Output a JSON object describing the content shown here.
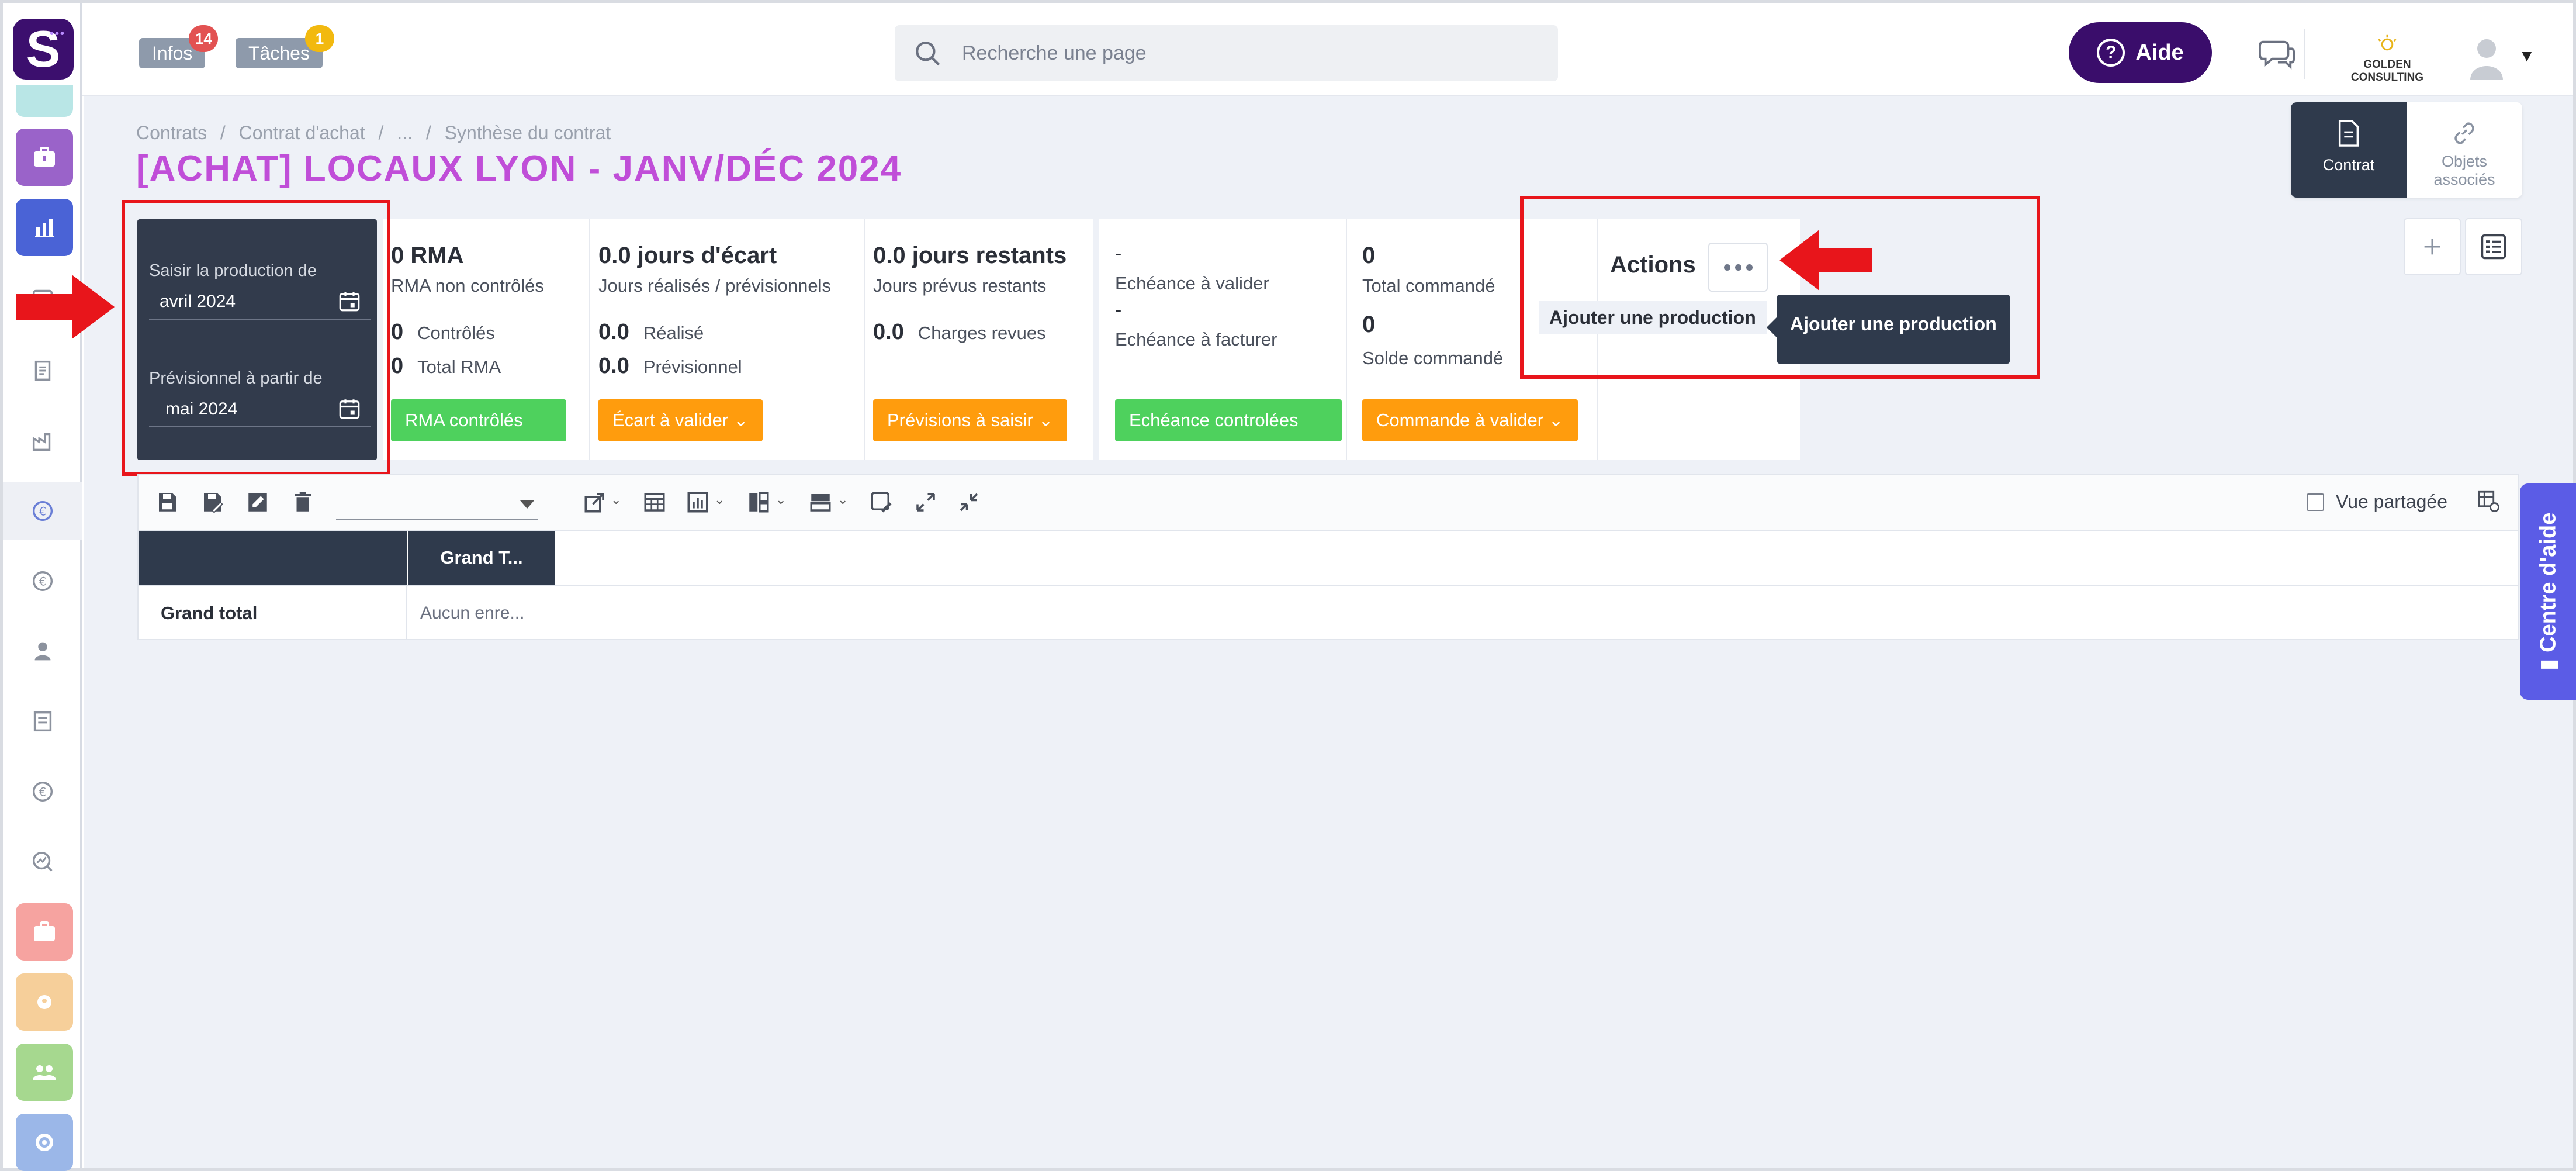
{
  "header": {
    "infos_label": "Infos",
    "infos_count": "14",
    "taches_label": "Tâches",
    "taches_count": "1",
    "search_placeholder": "Recherche une page",
    "help_label": "Aide",
    "company_name": "GOLDEN CONSULTING"
  },
  "breadcrumb": [
    "Contrats",
    "/",
    "Contrat d'achat",
    "/",
    "...",
    "/",
    "Synthèse du contrat"
  ],
  "page_title": "[ACHAT] LOCAUX LYON - JANV/DÉC 2024",
  "view_switch": {
    "contrat": "Contrat",
    "objets_1": "Objets",
    "objets_2": "associés"
  },
  "dates": {
    "production_label": "Saisir la production de",
    "production_value": "avril 2024",
    "forecast_label": "Prévisionnel à partir de",
    "forecast_value": "mai 2024"
  },
  "kpi": {
    "rma": {
      "title": "0 RMA",
      "subtitle": "RMA non contrôlés",
      "controles_value": "0",
      "controles_label": "Contrôlés",
      "total_value": "0",
      "total_label": "Total RMA",
      "button": "RMA contrôlés"
    },
    "ecart": {
      "title": "0.0 jours d'écart",
      "subtitle": "Jours réalisés / prévisionnels",
      "realise_value": "0.0",
      "realise_label": "Réalisé",
      "prev_value": "0.0",
      "prev_label": "Prévisionnel",
      "button": "Écart à valider"
    },
    "restants": {
      "title": "0.0 jours restants",
      "subtitle": "Jours prévus restants",
      "charges_value": "0.0",
      "charges_label": "Charges revues",
      "button": "Prévisions à saisir"
    },
    "echeance": {
      "dash1": "-",
      "valider": "Echéance à valider",
      "dash2": "-",
      "facturer": "Echéance à facturer",
      "button": "Echéance controlées"
    },
    "commande": {
      "total_value": "0",
      "total_label": "Total commandé",
      "solde_value": "0",
      "solde_label": "Solde commandé",
      "button": "Commande à valider"
    }
  },
  "actions": {
    "title": "Actions",
    "menu_item": "Ajouter une production",
    "tooltip": "Ajouter une production"
  },
  "table": {
    "shared_view": "Vue partagée",
    "col_header": "Grand T...",
    "row_label": "Grand total",
    "row_value": "Aucun enre..."
  },
  "help_center": "Centre d'aide",
  "colors": {
    "brand": "#3c0f6e",
    "title": "#c04ed8",
    "green": "#4ed15d",
    "orange": "#ff9c0d",
    "dark_panel": "#323b4c",
    "annotation_red": "#e8151b",
    "help_tab": "#5b5ce6"
  }
}
